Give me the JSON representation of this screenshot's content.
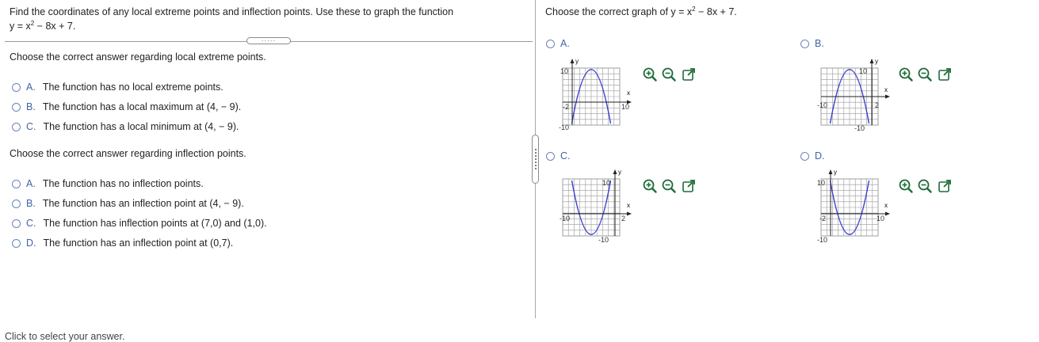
{
  "left": {
    "prompt_line1": "Find the coordinates of any local extreme points and inflection points. Use these to graph the function",
    "prompt_line2_pre": "y = x",
    "prompt_line2_sup": "2",
    "prompt_line2_post": " − 8x + 7.",
    "expand_dots": "·····",
    "q1": "Choose the correct answer regarding local extreme points.",
    "q1_options": [
      {
        "letter": "A.",
        "text": "The function has no local extreme points."
      },
      {
        "letter": "B.",
        "text": "The function has a local maximum at (4, − 9)."
      },
      {
        "letter": "C.",
        "text": "The function has a local minimum at (4, − 9)."
      }
    ],
    "q2": "Choose the correct answer regarding inflection points.",
    "q2_options": [
      {
        "letter": "A.",
        "text": "The function has no inflection points."
      },
      {
        "letter": "B.",
        "text": "The function has an inflection point at (4, − 9)."
      },
      {
        "letter": "C.",
        "text": "The function has inflection points at (7,0) and (1,0)."
      },
      {
        "letter": "D.",
        "text": "The function has an inflection point at (0,7)."
      }
    ],
    "footer": "Click to select your answer."
  },
  "right": {
    "question_pre": "Choose the correct graph of y = x",
    "question_sup": "2",
    "question_post": " − 8x + 7.",
    "graphs": [
      {
        "letter": "A.",
        "labels": [
          "10",
          "-2",
          "10",
          "-10"
        ],
        "shape": "opens-down"
      },
      {
        "letter": "B.",
        "labels": [
          "10",
          "-10",
          "2",
          "-10"
        ],
        "shape": "opens-down"
      },
      {
        "letter": "C.",
        "labels": [
          "10",
          "-10",
          "2",
          "-10"
        ],
        "shape": "opens-up"
      },
      {
        "letter": "D.",
        "labels": [
          "10",
          "-2",
          "10",
          "-10"
        ],
        "shape": "opens-up"
      }
    ],
    "axis_x": "x",
    "axis_y": "y"
  },
  "colors": {
    "curve": "#3a3fd0",
    "accent": "#3f63a8",
    "zoom_icon": "#1e6c3a"
  },
  "icons": [
    "zoom-in-icon",
    "zoom-out-icon",
    "external-link-icon"
  ]
}
